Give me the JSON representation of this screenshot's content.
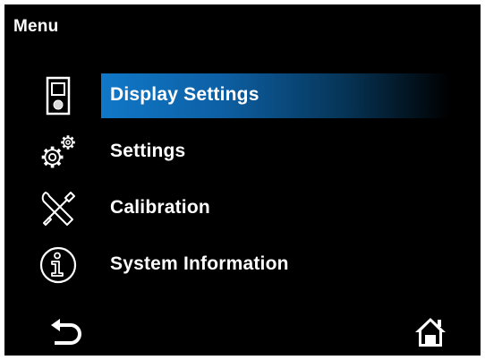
{
  "header": {
    "title": "Menu"
  },
  "menu": {
    "items": [
      {
        "label": "Display Settings",
        "icon": "display-icon",
        "selected": true
      },
      {
        "label": "Settings",
        "icon": "gears-icon",
        "selected": false
      },
      {
        "label": "Calibration",
        "icon": "tools-icon",
        "selected": false
      },
      {
        "label": "System Information",
        "icon": "info-icon",
        "selected": false
      }
    ]
  },
  "footer": {
    "back_icon": "back-arrow-icon",
    "home_icon": "home-icon"
  },
  "colors": {
    "background": "#000000",
    "text": "#ffffff",
    "highlight": "#1078c8"
  }
}
